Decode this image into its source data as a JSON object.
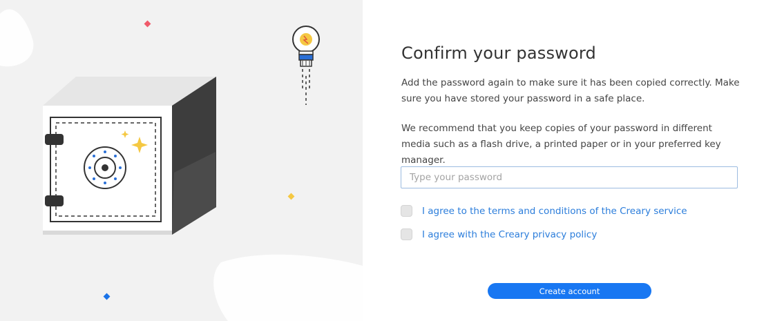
{
  "heading": {
    "title": "Confirm your password"
  },
  "instructions": {
    "paragraph_1": "Add the password again to make sure it has been copied correctly. Make sure you have stored your password in a safe place.",
    "paragraph_2": "We recommend that you keep copies of your password in different media such as a flash drive, a printed paper or in your preferred key manager."
  },
  "password_field": {
    "placeholder": "Type your password",
    "value": ""
  },
  "agreements": [
    {
      "label": "I agree to the terms and conditions of the Creary service",
      "checked": false
    },
    {
      "label": "I agree with the Creary privacy policy",
      "checked": false
    }
  ],
  "actions": {
    "create_label": "Create account"
  },
  "colors": {
    "accent": "#1877f2",
    "link": "#2b7ddb",
    "left_background": "#f2f2f2",
    "diamond_red": "#f05a6a",
    "diamond_yellow": "#f5c842",
    "diamond_blue": "#1a73e8"
  },
  "icons": {
    "illustration": "safe-illustration",
    "bulb": "lightbulb-icon",
    "sparkle": "sparkle-icon",
    "dial": "safe-dial-icon"
  }
}
